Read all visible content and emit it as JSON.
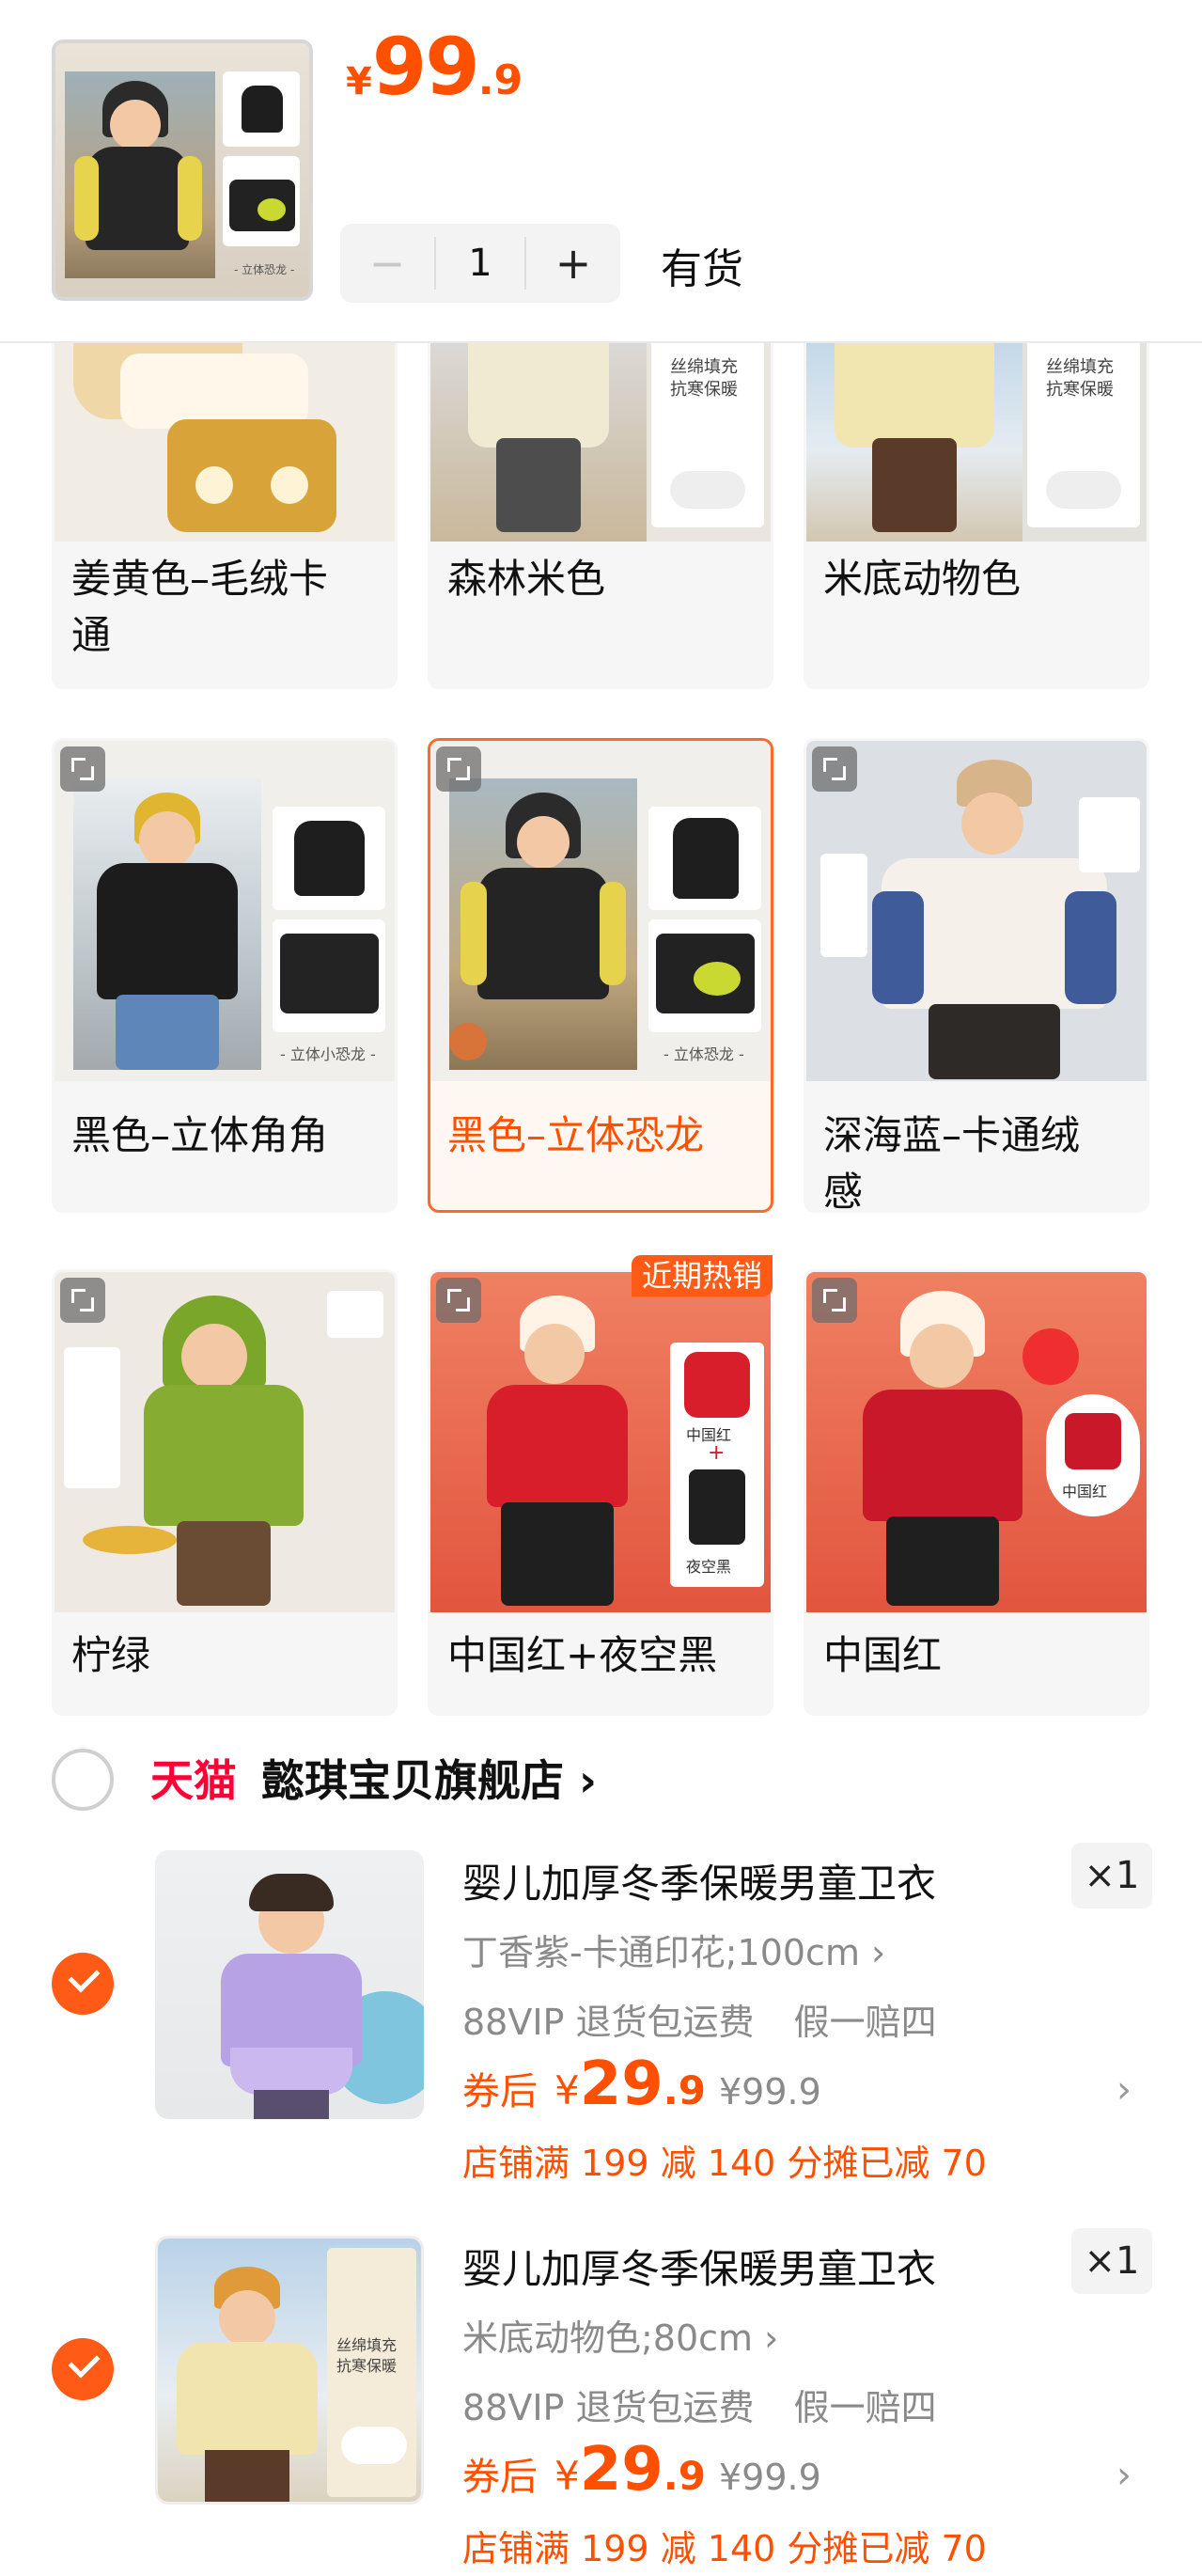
{
  "header": {
    "price_symbol": "¥",
    "price_int": "99",
    "price_dec": ".9",
    "qty_minus": "−",
    "qty_value": "1",
    "qty_plus": "+",
    "stock": "有货",
    "thumb_caption": "- 立体恐龙 -"
  },
  "variants": [
    {
      "label_l1": "姜黄色–毛绒卡",
      "label_l2": "通"
    },
    {
      "label_l1": "森林米色",
      "label_l2": ""
    },
    {
      "label_l1": "米底动物色",
      "label_l2": ""
    },
    {
      "label_l1": "黑色–立体角角",
      "label_l2": "",
      "caption": "- 立体小恐龙 -"
    },
    {
      "label_l1": "黑色–立体恐龙",
      "label_l2": "",
      "caption": "- 立体恐龙 -"
    },
    {
      "label_l1": "深海蓝–卡通绒",
      "label_l2": "感"
    },
    {
      "label_l1": "柠绿",
      "label_l2": ""
    },
    {
      "label_l1": "中国红+夜空黑",
      "label_l2": ""
    },
    {
      "label_l1": "中国红",
      "label_l2": ""
    }
  ],
  "insert_text": {
    "fill": "丝绵填充",
    "warm": "抗寒保暖",
    "red": "中国红",
    "plus": "+",
    "night": "夜空黑"
  },
  "hot_badge": "近期热销",
  "store": {
    "platform": "天猫",
    "name": "懿琪宝贝旗舰店 ›"
  },
  "cart_items": [
    {
      "title": "婴儿加厚冬季保暖男童卫衣",
      "spec": "丁香紫-卡通印花;100cm ›",
      "tag1": "88VIP 退货包运费",
      "tag2": "假一赔四",
      "after_label": "券后",
      "price_symbol": "¥",
      "price_int": "29",
      "price_dec": ".9",
      "orig_price": "¥99.9",
      "promo": "店铺满 199 减 140 分摊已减 70",
      "qty": "×1",
      "chevron": "›"
    },
    {
      "title": "婴儿加厚冬季保暖男童卫衣",
      "spec": "米底动物色;80cm ›",
      "tag1": "88VIP 退货包运费",
      "tag2": "假一赔四",
      "after_label": "券后",
      "price_symbol": "¥",
      "price_int": "29",
      "price_dec": ".9",
      "orig_price": "¥99.9",
      "promo": "店铺满 199 减 140 分摊已减 70",
      "qty": "×1",
      "chevron": "›"
    }
  ],
  "colors": {
    "accent": "#ff5000",
    "tmall": "#ff0036",
    "selected_border": "#ff6a2b"
  }
}
